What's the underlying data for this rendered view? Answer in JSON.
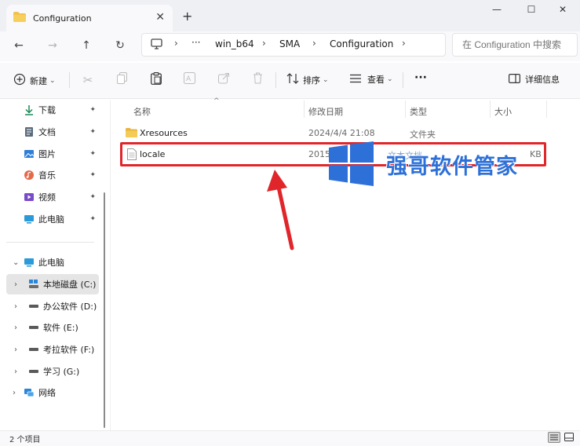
{
  "window": {
    "tab_title": "Configuration",
    "tab_close_glyph": "✕",
    "new_tab_glyph": "+",
    "minimize_glyph": "—",
    "maximize_glyph": "☐",
    "close_glyph": "✕"
  },
  "nav": {
    "back": "←",
    "forward": "→",
    "up": "↑",
    "refresh": "↻"
  },
  "address": {
    "more": "···",
    "crumbs": [
      "win_b64",
      "SMA",
      "Configuration"
    ],
    "separator": "›",
    "search_placeholder": "在 Configuration 中搜索"
  },
  "commands": {
    "new_label": "新建",
    "sort_label": "排序",
    "view_label": "查看",
    "more_label": "···",
    "details_label": "详细信息",
    "dropdown_glyph": "⌄"
  },
  "sidebar": {
    "quick_access": [
      {
        "label": "下载",
        "icon": "download-icon"
      },
      {
        "label": "文档",
        "icon": "document-icon"
      },
      {
        "label": "图片",
        "icon": "picture-icon"
      },
      {
        "label": "音乐",
        "icon": "music-icon"
      },
      {
        "label": "视频",
        "icon": "video-icon"
      },
      {
        "label": "此电脑",
        "icon": "computer-icon"
      }
    ],
    "this_pc": "此电脑",
    "drives": [
      {
        "label": "本地磁盘 (C:)",
        "selected": true
      },
      {
        "label": "办公软件 (D:)",
        "selected": false
      },
      {
        "label": "软件 (E:)",
        "selected": false
      },
      {
        "label": "考拉软件 (F:)",
        "selected": false
      },
      {
        "label": "学习 (G:)",
        "selected": false
      }
    ],
    "network": "网络",
    "pin_glyph": "📌"
  },
  "list": {
    "columns": [
      "名称",
      "修改日期",
      "类型",
      "大小"
    ],
    "sort_caret": "^",
    "rows": [
      {
        "name": "Xresources",
        "date": "2024/4/4 21:08",
        "type": "文件夹",
        "size": "",
        "icon": "folder-icon"
      },
      {
        "name": "locale",
        "date": "2015",
        "type": "文本文档",
        "size": "KB",
        "icon": "text-file-icon"
      }
    ]
  },
  "watermark": {
    "text": "强哥软件管家",
    "logo_color": "#2d70d8"
  },
  "status": {
    "item_count": "2 个项目"
  },
  "colors": {
    "accent": "#0067c0",
    "highlight_red": "#e0262b",
    "folder_yellow": "#f2c24c"
  }
}
